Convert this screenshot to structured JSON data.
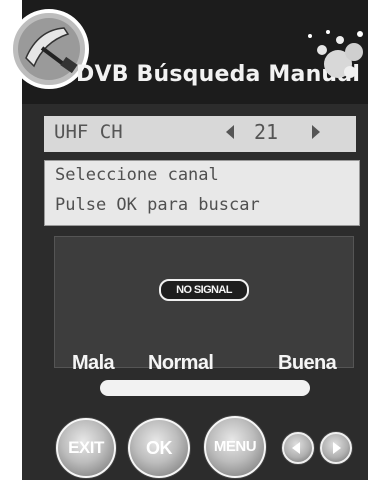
{
  "header": {
    "title": "DVB Búsqueda Manual",
    "logo_icon": "satellite-dish-icon",
    "decor_icon": "bubbles-icon"
  },
  "channel": {
    "band": "UHF  CH",
    "number": "21"
  },
  "message": {
    "line1": "Seleccione canal",
    "line2": "Pulse OK para buscar"
  },
  "preview": {
    "status": "NO SIGNAL"
  },
  "signal": {
    "low_label": "Mala",
    "mid_label": "Normal",
    "high_label": "Buena",
    "level_percent": 0
  },
  "buttons": {
    "exit": "EXIT",
    "ok": "OK",
    "menu": "MENU"
  },
  "colors": {
    "background": "#2c2c2c",
    "title_bar": "#1c1c1c",
    "panel": "#d8d8d8",
    "text_light": "#f2f2f2",
    "text_dark": "#555555"
  }
}
